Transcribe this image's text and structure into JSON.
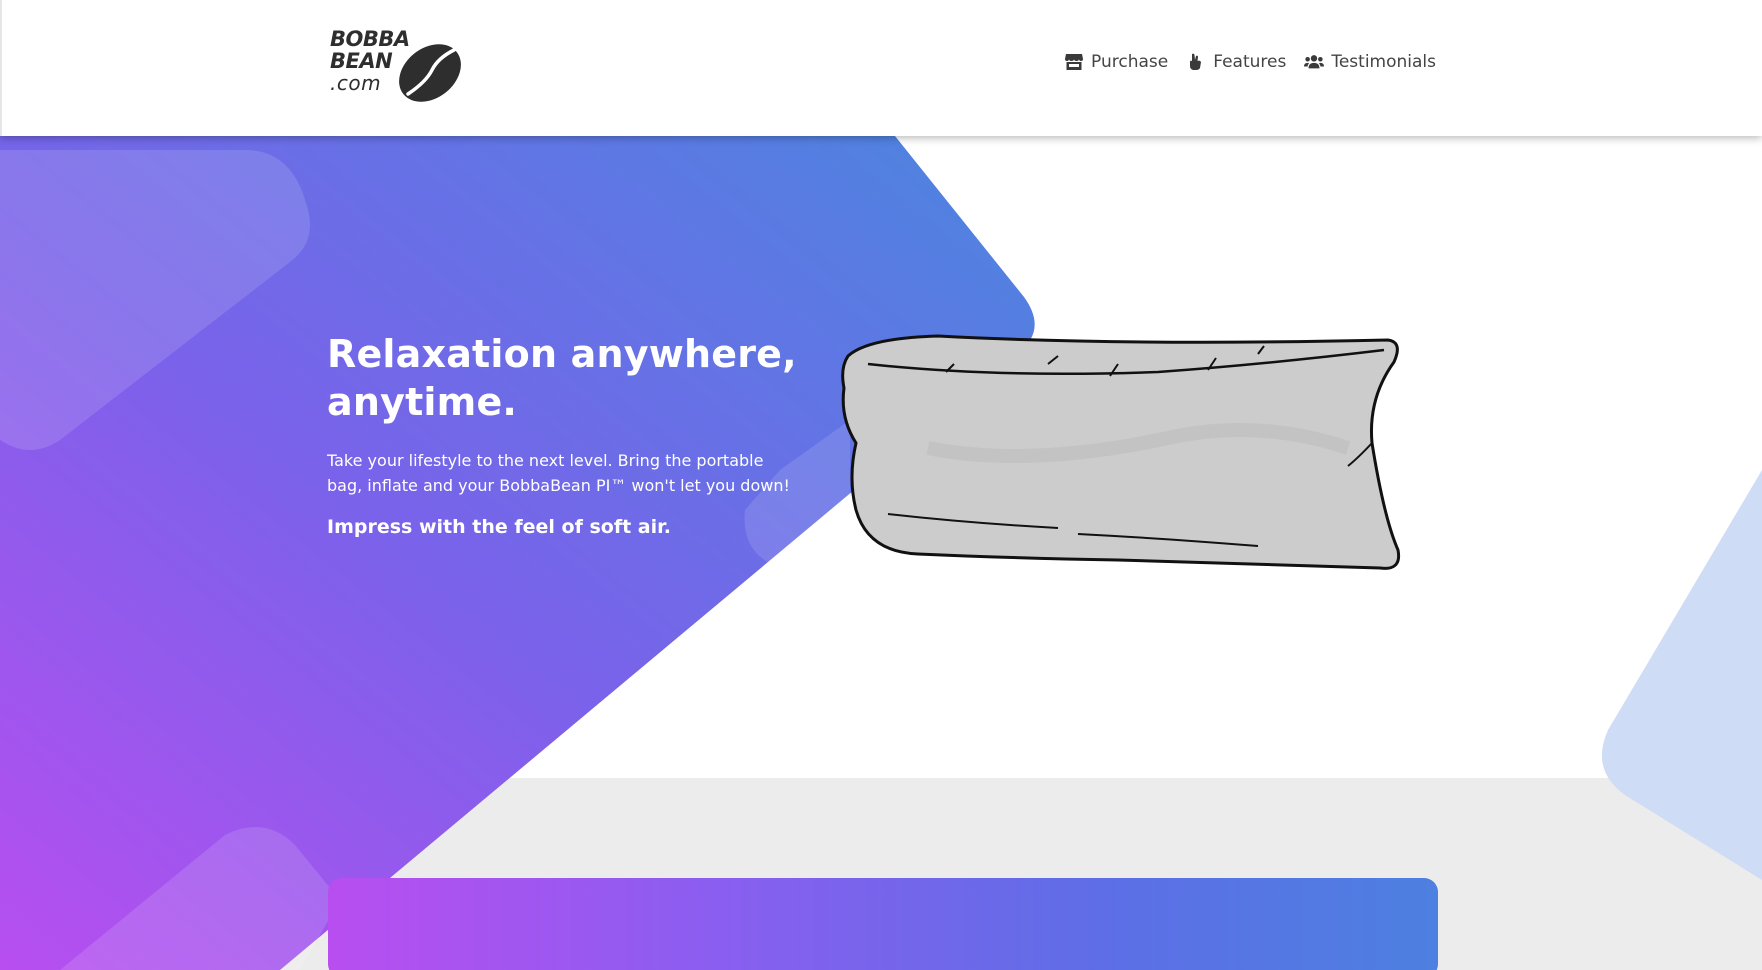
{
  "logo": {
    "line1": "BOBBA",
    "line2": "BEAN",
    "line3": ".com",
    "icon": "coffee-bean-icon"
  },
  "nav": {
    "items": [
      {
        "label": "Purchase",
        "icon": "store-icon"
      },
      {
        "label": "Features",
        "icon": "hand-pointer-icon"
      },
      {
        "label": "Testimonials",
        "icon": "users-icon"
      }
    ]
  },
  "hero": {
    "title_line1": "Relaxation anywhere,",
    "title_line2": "anytime.",
    "body": "Take your lifestyle to the next level. Bring the portable bag, inflate and your BobbaBean PI™ won't let you down!",
    "tagline": "Impress with the feel of soft air.",
    "image": "inflatable-air-lounger-illustration"
  },
  "colors": {
    "gradient_purple": "#b84ef0",
    "gradient_blue": "#4d80e0",
    "nav_text": "#444444",
    "logo_text": "#2e2e2e",
    "band_gray": "#ececec"
  }
}
